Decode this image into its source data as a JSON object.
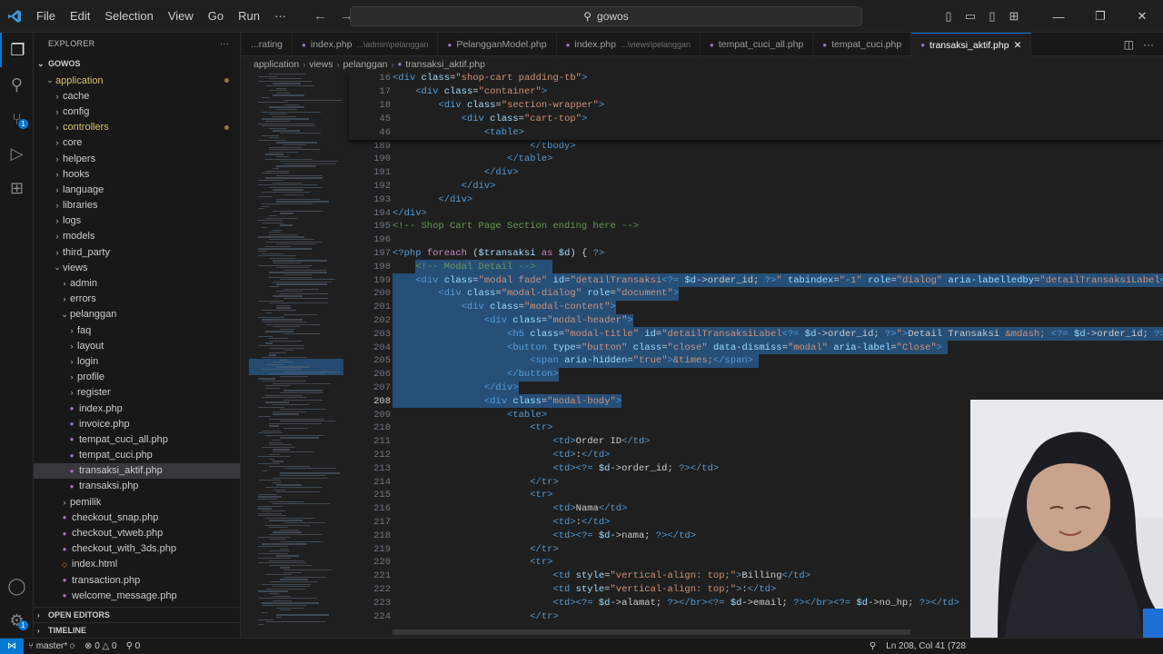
{
  "titlebar": {
    "menu": [
      "File",
      "Edit",
      "Selection",
      "View",
      "Go",
      "Run",
      "···"
    ],
    "search_text": "gowos"
  },
  "sidebar": {
    "header": "EXPLORER",
    "root": "GOWOS",
    "items": [
      {
        "label": "application",
        "depth": 1,
        "kind": "folder-open",
        "dot": true,
        "yellow": true
      },
      {
        "label": "cache",
        "depth": 2,
        "kind": "folder"
      },
      {
        "label": "config",
        "depth": 2,
        "kind": "folder"
      },
      {
        "label": "controllers",
        "depth": 2,
        "kind": "folder",
        "dot": true,
        "yellow": true
      },
      {
        "label": "core",
        "depth": 2,
        "kind": "folder"
      },
      {
        "label": "helpers",
        "depth": 2,
        "kind": "folder"
      },
      {
        "label": "hooks",
        "depth": 2,
        "kind": "folder"
      },
      {
        "label": "language",
        "depth": 2,
        "kind": "folder"
      },
      {
        "label": "libraries",
        "depth": 2,
        "kind": "folder"
      },
      {
        "label": "logs",
        "depth": 2,
        "kind": "folder"
      },
      {
        "label": "models",
        "depth": 2,
        "kind": "folder"
      },
      {
        "label": "third_party",
        "depth": 2,
        "kind": "folder"
      },
      {
        "label": "views",
        "depth": 2,
        "kind": "folder-open"
      },
      {
        "label": "admin",
        "depth": 3,
        "kind": "folder"
      },
      {
        "label": "errors",
        "depth": 3,
        "kind": "folder"
      },
      {
        "label": "pelanggan",
        "depth": 3,
        "kind": "folder-open"
      },
      {
        "label": "faq",
        "depth": 4,
        "kind": "folder"
      },
      {
        "label": "layout",
        "depth": 4,
        "kind": "folder"
      },
      {
        "label": "login",
        "depth": 4,
        "kind": "folder"
      },
      {
        "label": "profile",
        "depth": 4,
        "kind": "folder"
      },
      {
        "label": "register",
        "depth": 4,
        "kind": "folder"
      },
      {
        "label": "index.php",
        "depth": 4,
        "kind": "php"
      },
      {
        "label": "invoice.php",
        "depth": 4,
        "kind": "php"
      },
      {
        "label": "tempat_cuci_all.php",
        "depth": 4,
        "kind": "php"
      },
      {
        "label": "tempat_cuci.php",
        "depth": 4,
        "kind": "php"
      },
      {
        "label": "transaksi_aktif.php",
        "depth": 4,
        "kind": "php",
        "selected": true
      },
      {
        "label": "transaksi.php",
        "depth": 4,
        "kind": "php"
      },
      {
        "label": "pemilik",
        "depth": 3,
        "kind": "folder"
      },
      {
        "label": "checkout_snap.php",
        "depth": 3,
        "kind": "php"
      },
      {
        "label": "checkout_vtweb.php",
        "depth": 3,
        "kind": "php"
      },
      {
        "label": "checkout_with_3ds.php",
        "depth": 3,
        "kind": "php"
      },
      {
        "label": "index.html",
        "depth": 3,
        "kind": "html"
      },
      {
        "label": "transaction.php",
        "depth": 3,
        "kind": "php"
      },
      {
        "label": "welcome_message.php",
        "depth": 3,
        "kind": "php"
      }
    ],
    "open_editors": "OPEN EDITORS",
    "timeline": "TIMELINE"
  },
  "tabs": [
    {
      "label": "...rating",
      "dir": ""
    },
    {
      "label": "index.php",
      "dir": "...\\admin\\pelanggan"
    },
    {
      "label": "PelangganModel.php",
      "dir": ""
    },
    {
      "label": "index.php",
      "dir": "...\\views\\pelanggan"
    },
    {
      "label": "tempat_cuci_all.php",
      "dir": ""
    },
    {
      "label": "tempat_cuci.php",
      "dir": ""
    },
    {
      "label": "transaksi_aktif.php",
      "dir": "",
      "active": true
    }
  ],
  "breadcrumb": [
    "application",
    "views",
    "pelanggan",
    "transaksi_aktif.php"
  ],
  "editor": {
    "sticky_lines": [
      {
        "n": "16",
        "html": "<span class='t'>&lt;div</span> <span class='a'>class</span>=<span class='s'>\"shop-cart padding-tb\"</span><span class='t'>&gt;</span>"
      },
      {
        "n": "17",
        "html": "    <span class='t'>&lt;div</span> <span class='a'>class</span>=<span class='s'>\"container\"</span><span class='t'>&gt;</span>"
      },
      {
        "n": "18",
        "html": "        <span class='t'>&lt;div</span> <span class='a'>class</span>=<span class='s'>\"section-wrapper\"</span><span class='t'>&gt;</span>"
      },
      {
        "n": "45",
        "html": "            <span class='t'>&lt;div</span> <span class='a'>class</span>=<span class='s'>\"cart-top\"</span><span class='t'>&gt;</span>"
      },
      {
        "n": "46",
        "html": "                <span class='t'>&lt;table&gt;</span>"
      }
    ],
    "lines": [
      {
        "n": "189",
        "html": "                        <span class='t'>&lt;/tbody&gt;</span>"
      },
      {
        "n": "190",
        "html": "                    <span class='t'>&lt;/table&gt;</span>"
      },
      {
        "n": "191",
        "html": "                <span class='t'>&lt;/div&gt;</span>"
      },
      {
        "n": "192",
        "html": "            <span class='t'>&lt;/div&gt;</span>"
      },
      {
        "n": "193",
        "html": "        <span class='t'>&lt;/div&gt;</span>"
      },
      {
        "n": "194",
        "html": "<span class='t'>&lt;/div&gt;</span>"
      },
      {
        "n": "195",
        "html": "<span class='c'>&lt;!-- Shop Cart Page Section ending here --&gt;</span>"
      },
      {
        "n": "196",
        "html": ""
      },
      {
        "n": "197",
        "html": "<span class='t'>&lt;?php</span> <span class='p'>foreach</span> (<span class='v'>$transaksi</span> <span class='p'>as</span> <span class='v'>$d</span>) { <span class='t'>?&gt;</span>"
      },
      {
        "n": "198",
        "sel": [
          4,
          24
        ],
        "html": "    <span class='c'>&lt;!-- Modal Detail --&gt;</span>"
      },
      {
        "n": "199",
        "sel": [
          0,
          140
        ],
        "html": "    <span class='t'>&lt;div</span> <span class='a'>class</span>=<span class='s'>\"modal fade\"</span> <span class='a'>id</span>=<span class='s'>\"detailTransaksi</span><span class='t'>&lt;?=</span> <span class='v'>$d</span>-&gt;order_id; <span class='t'>?&gt;</span><span class='s'>\"</span> <span class='a'>tabindex</span>=<span class='s'>\"-1\"</span> <span class='a'>role</span>=<span class='s'>\"dialog\"</span> <span class='a'>aria-labelledby</span>=<span class='s'>\"detailTransaksiLabel</span><span class='t'>&lt;?=</span> <span class='v'>$d</span>-"
      },
      {
        "n": "200",
        "sel": [
          0,
          50
        ],
        "html": "        <span class='t'>&lt;div</span> <span class='a'>class</span>=<span class='s'>\"modal-dialog\"</span> <span class='a'>role</span>=<span class='s'>\"document\"</span><span class='t'>&gt;</span>"
      },
      {
        "n": "201",
        "sel": [
          0,
          39
        ],
        "html": "            <span class='t'>&lt;div</span> <span class='a'>class</span>=<span class='s'>\"modal-content\"</span><span class='t'>&gt;</span>"
      },
      {
        "n": "202",
        "sel": [
          0,
          42
        ],
        "html": "                <span class='t'>&lt;div</span> <span class='a'>class</span>=<span class='s'>\"modal-header\"</span><span class='t'>&gt;</span>"
      },
      {
        "n": "203",
        "sel": [
          0,
          140
        ],
        "html": "                    <span class='t'>&lt;h5</span> <span class='a'>class</span>=<span class='s'>\"modal-title\"</span> <span class='a'>id</span>=<span class='s'>\"detailTransaksiLabel</span><span class='t'>&lt;?=</span> <span class='v'>$d</span>-&gt;order_id; <span class='t'>?&gt;</span><span class='s'>\"</span><span class='t'>&gt;</span>Detail Transaksi <span class='s'>&amp;mdash;</span> <span class='t'>&lt;?=</span> <span class='v'>$d</span>-&gt;order_id; <span class='t'>?&gt;&lt;/h5&gt;</span>"
      },
      {
        "n": "204",
        "sel": [
          0,
          97
        ],
        "html": "                    <span class='t'>&lt;button</span> <span class='a'>type</span>=<span class='s'>\"button\"</span> <span class='a'>class</span>=<span class='s'>\"close\"</span> <span class='a'>data-dismiss</span>=<span class='s'>\"modal\"</span> <span class='a'>aria-label</span>=<span class='s'>\"Close\"</span><span class='t'>&gt;</span>"
      },
      {
        "n": "205",
        "sel": [
          0,
          64
        ],
        "html": "                        <span class='t'>&lt;span</span> <span class='a'>aria-hidden</span>=<span class='s'>\"true\"</span><span class='t'>&gt;</span><span class='s'>&amp;times;</span><span class='t'>&lt;/span&gt;</span>"
      },
      {
        "n": "206",
        "sel": [
          0,
          29
        ],
        "html": "                    <span class='t'>&lt;/button&gt;</span>"
      },
      {
        "n": "207",
        "sel": [
          0,
          22
        ],
        "html": "                <span class='t'>&lt;/div&gt;</span>"
      },
      {
        "n": "208",
        "sel": [
          0,
          40
        ],
        "cur": true,
        "html": "                <span class='t'>&lt;div</span> <span class='a'>class</span>=<span class='s'>\"modal-body\"</span><span class='t'>&gt;</span>"
      },
      {
        "n": "209",
        "html": "                    <span class='t'>&lt;table&gt;</span>"
      },
      {
        "n": "210",
        "html": "                        <span class='t'>&lt;tr&gt;</span>"
      },
      {
        "n": "211",
        "html": "                            <span class='t'>&lt;td&gt;</span>Order ID<span class='t'>&lt;/td&gt;</span>"
      },
      {
        "n": "212",
        "html": "                            <span class='t'>&lt;td&gt;</span>:<span class='t'>&lt;/td&gt;</span>"
      },
      {
        "n": "213",
        "html": "                            <span class='t'>&lt;td&gt;&lt;?=</span> <span class='v'>$d</span>-&gt;order_id; <span class='t'>?&gt;&lt;/td&gt;</span>"
      },
      {
        "n": "214",
        "html": "                        <span class='t'>&lt;/tr&gt;</span>"
      },
      {
        "n": "215",
        "html": "                        <span class='t'>&lt;tr&gt;</span>"
      },
      {
        "n": "216",
        "html": "                            <span class='t'>&lt;td&gt;</span>Nama<span class='t'>&lt;/td&gt;</span>"
      },
      {
        "n": "217",
        "html": "                            <span class='t'>&lt;td&gt;</span>:<span class='t'>&lt;/td&gt;</span>"
      },
      {
        "n": "218",
        "html": "                            <span class='t'>&lt;td&gt;&lt;?=</span> <span class='v'>$d</span>-&gt;nama; <span class='t'>?&gt;&lt;/td&gt;</span>"
      },
      {
        "n": "219",
        "html": "                        <span class='t'>&lt;/tr&gt;</span>"
      },
      {
        "n": "220",
        "html": "                        <span class='t'>&lt;tr&gt;</span>"
      },
      {
        "n": "221",
        "html": "                            <span class='t'>&lt;td</span> <span class='a'>style</span>=<span class='s'>\"vertical-align: top;\"</span><span class='t'>&gt;</span>Billing<span class='t'>&lt;/td&gt;</span>"
      },
      {
        "n": "222",
        "html": "                            <span class='t'>&lt;td</span> <span class='a'>style</span>=<span class='s'>\"vertical-align: top;\"</span><span class='t'>&gt;</span>:<span class='t'>&lt;/td&gt;</span>"
      },
      {
        "n": "223",
        "html": "                            <span class='t'>&lt;td&gt;&lt;?=</span> <span class='v'>$d</span>-&gt;alamat; <span class='t'>?&gt;&lt;/br&gt;&lt;?=</span> <span class='v'>$d</span>-&gt;email; <span class='t'>?&gt;&lt;/br&gt;&lt;?=</span> <span class='v'>$d</span>-&gt;no_hp; <span class='t'>?&gt;&lt;/td&gt;</span>"
      },
      {
        "n": "224",
        "html": "                        <span class='t'>&lt;/tr&gt;</span>"
      }
    ]
  },
  "statusbar": {
    "branch": "master*",
    "errors": "0",
    "warnings": "0",
    "ports": "0",
    "position": "Ln 208, Col 41 (728"
  }
}
